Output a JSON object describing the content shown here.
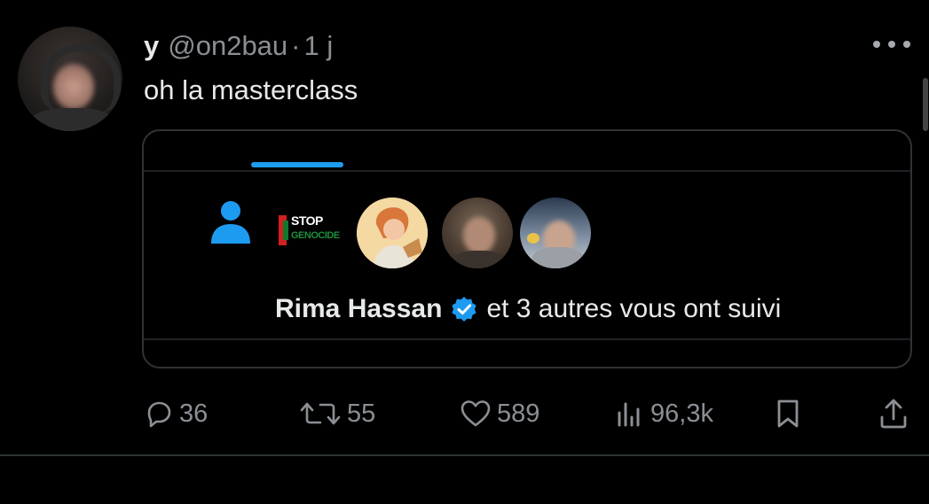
{
  "tweet": {
    "author_name": "y",
    "handle": "@on2bau",
    "separator": "·",
    "time": "1 j",
    "text": "oh la masterclass"
  },
  "card": {
    "stop_logo_line1": "STOP",
    "stop_logo_line2": "GENOCIDE",
    "followed_name": "Rima Hassan",
    "followed_rest": "et 3 autres vous ont suivi"
  },
  "actions": {
    "replies": "36",
    "retweets": "55",
    "likes": "589",
    "views": "96,3k"
  },
  "icons": {
    "more": "more-icon",
    "reply": "reply-icon",
    "retweet": "retweet-icon",
    "like": "heart-icon",
    "views": "views-icon",
    "bookmark": "bookmark-icon",
    "share": "share-icon",
    "person": "person-icon",
    "verified": "verified-badge-icon"
  },
  "colors": {
    "accent": "#1d9bf0",
    "muted": "#8b8f94",
    "background": "#000000"
  }
}
